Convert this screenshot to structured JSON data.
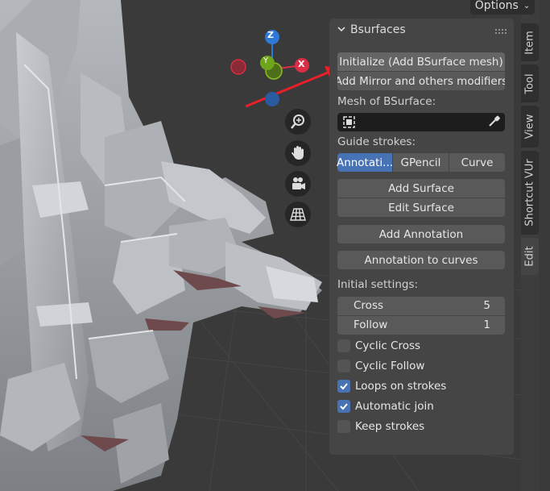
{
  "header": {
    "options_label": "Options"
  },
  "gizmo": {
    "z": "Z",
    "y": "Y",
    "x": "X"
  },
  "panel": {
    "title": "Bsurfaces",
    "initialize_label": "Initialize (Add BSurface mesh)",
    "mirror_label": "Add Mirror and others modifiers",
    "mesh_label": "Mesh of BSurface:",
    "guide_label": "Guide strokes:",
    "guide_options": [
      "Annotati...",
      "GPencil",
      "Curve"
    ],
    "guide_selected": "Annotati...",
    "add_surface_label": "Add Surface",
    "edit_surface_label": "Edit Surface",
    "add_annotation_label": "Add Annotation",
    "annotation_curves_label": "Annotation to curves",
    "initial_settings_label": "Initial settings:",
    "cross": {
      "label": "Cross",
      "value": "5"
    },
    "follow": {
      "label": "Follow",
      "value": "1"
    },
    "checkboxes": [
      {
        "label": "Cyclic Cross",
        "checked": false
      },
      {
        "label": "Cyclic Follow",
        "checked": false
      },
      {
        "label": "Loops on strokes",
        "checked": true
      },
      {
        "label": "Automatic join",
        "checked": true
      },
      {
        "label": "Keep strokes",
        "checked": false
      }
    ]
  },
  "tabs": [
    "Item",
    "Tool",
    "View",
    "Shortcut VUr",
    "Edit"
  ],
  "active_tab": "Edit",
  "colors": {
    "accent": "#4772b3",
    "panel": "#454545",
    "button": "#595959",
    "arrow": "#e8202a"
  }
}
